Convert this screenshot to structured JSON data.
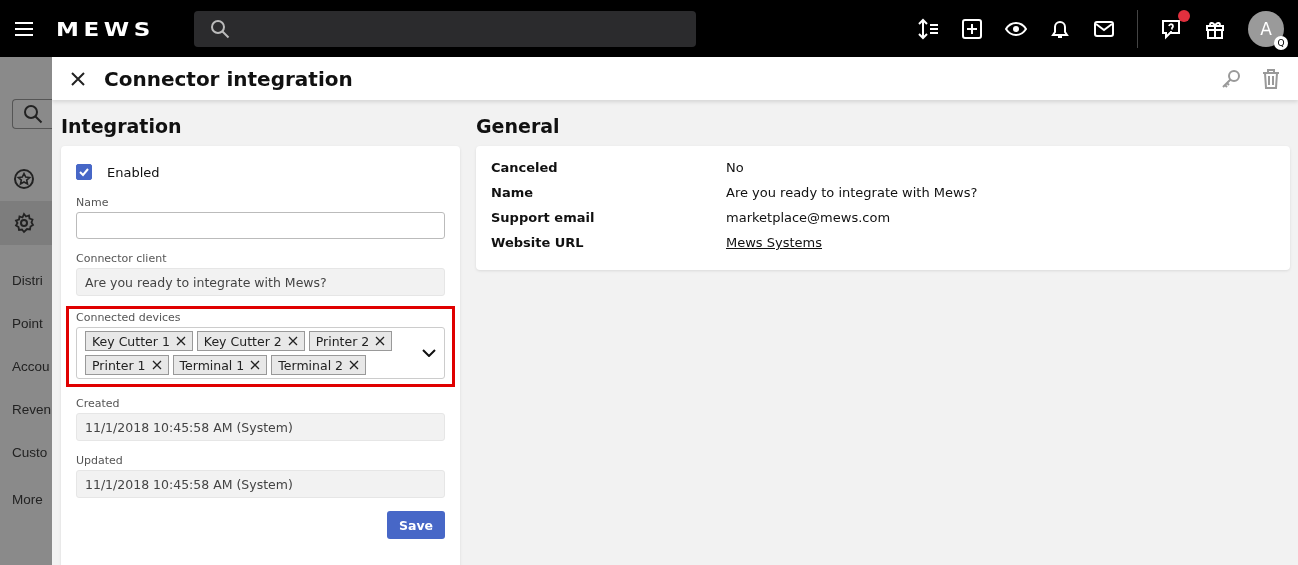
{
  "topbar": {
    "logo": "MEWS",
    "avatar": {
      "initial": "A",
      "badge": "Q"
    },
    "help_notification": true
  },
  "background_nav": {
    "items": [
      {
        "label": "Distri"
      },
      {
        "label": "Point"
      },
      {
        "label": "Accou"
      },
      {
        "label": "Reven"
      },
      {
        "label": "Custo"
      },
      {
        "label": "More"
      }
    ]
  },
  "panel": {
    "title": "Connector integration"
  },
  "integration": {
    "heading": "Integration",
    "enabled": {
      "label": "Enabled",
      "checked": true
    },
    "fields": [
      {
        "kind": "input",
        "label": "Name"
      },
      {
        "kind": "readonly",
        "label": "Connector client",
        "value": "Are you ready to integrate with Mews?"
      },
      {
        "kind": "tags",
        "label": "Connected devices",
        "highlighted": true,
        "tags": [
          "Key Cutter 1",
          "Key Cutter 2",
          "Printer 2",
          "Printer 1",
          "Terminal 1",
          "Terminal 2"
        ]
      },
      {
        "kind": "readonly",
        "label": "Created",
        "value": "11/1/2018 10:45:58 AM (System)"
      },
      {
        "kind": "readonly",
        "label": "Updated",
        "value": "11/1/2018 10:45:58 AM (System)"
      }
    ],
    "save": "Save"
  },
  "general": {
    "heading": "General",
    "rows": [
      {
        "kind": "text",
        "label": "Canceled",
        "value": "No"
      },
      {
        "kind": "text",
        "label": "Name",
        "value": "Are you ready to integrate with Mews?"
      },
      {
        "kind": "text",
        "label": "Support email",
        "value": "marketplace@mews.com"
      },
      {
        "kind": "link",
        "label": "Website URL",
        "value": "Mews Systems"
      }
    ]
  }
}
